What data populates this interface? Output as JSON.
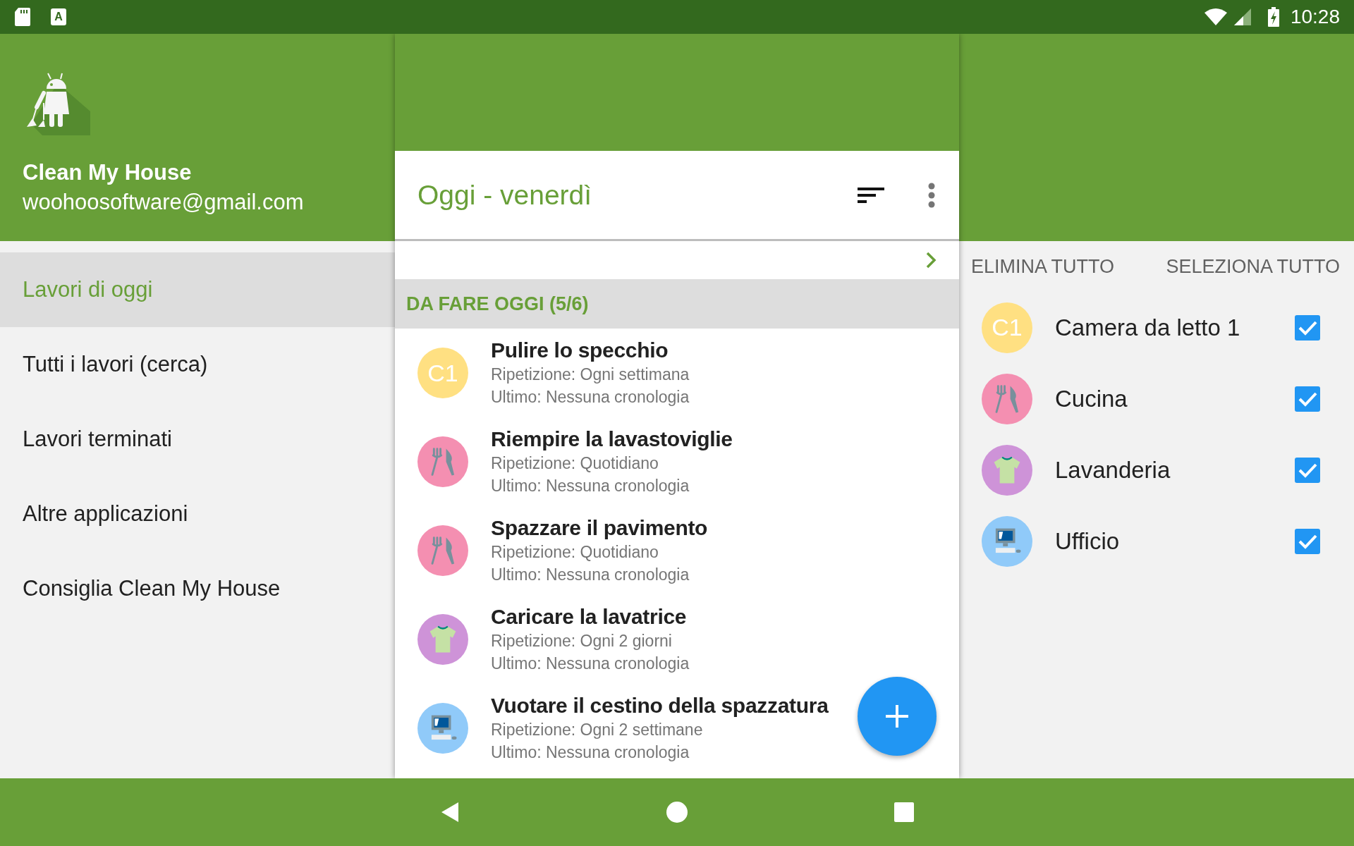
{
  "status_bar": {
    "keyboard_glyph": "A",
    "time": "10:28"
  },
  "drawer": {
    "app_name": "Clean My House",
    "email": "woohoosoftware@gmail.com",
    "items": [
      {
        "label": "Lavori di oggi",
        "selected": true
      },
      {
        "label": "Tutti i lavori (cerca)",
        "selected": false
      },
      {
        "label": "Lavori terminati",
        "selected": false
      },
      {
        "label": "Altre applicazioni",
        "selected": false
      },
      {
        "label": "Consiglia Clean My House",
        "selected": false
      }
    ]
  },
  "task_panel": {
    "title": "Oggi - venerdì",
    "section": "DA FARE OGGI (5/6)",
    "tasks": [
      {
        "title": "Pulire lo specchio",
        "repeat": "Ripetizione: Ogni settimana",
        "last": "Ultimo: Nessuna cronologia",
        "icon": {
          "kind": "initials",
          "text": "C1",
          "color": "#ffe082"
        }
      },
      {
        "title": "Riempire la lavastoviglie",
        "repeat": "Ripetizione: Quotidiano",
        "last": "Ultimo: Nessuna cronologia",
        "icon": {
          "kind": "cutlery",
          "color": "#f48fb1"
        }
      },
      {
        "title": "Spazzare il pavimento",
        "repeat": "Ripetizione: Quotidiano",
        "last": "Ultimo: Nessuna cronologia",
        "icon": {
          "kind": "cutlery",
          "color": "#f48fb1"
        }
      },
      {
        "title": "Caricare la lavatrice",
        "repeat": "Ripetizione: Ogni 2 giorni",
        "last": "Ultimo: Nessuna cronologia",
        "icon": {
          "kind": "shirt",
          "color": "#ce93d8"
        }
      },
      {
        "title": "Vuotare il cestino della spazzatura",
        "repeat": "Ripetizione: Ogni 2 settimane",
        "last": "Ultimo: Nessuna cronologia",
        "icon": {
          "kind": "computer",
          "color": "#90caf9"
        }
      }
    ]
  },
  "room_panel": {
    "actions": [
      "ELIMINA TUTTO",
      "SELEZIONA TUTTO"
    ],
    "rooms": [
      {
        "name": "Camera da letto 1",
        "checked": true,
        "icon": {
          "kind": "initials",
          "text": "C1",
          "color": "#ffe082"
        }
      },
      {
        "name": "Cucina",
        "checked": true,
        "icon": {
          "kind": "cutlery",
          "color": "#f48fb1"
        }
      },
      {
        "name": "Lavanderia",
        "checked": true,
        "icon": {
          "kind": "shirt",
          "color": "#ce93d8"
        }
      },
      {
        "name": "Ufficio",
        "checked": true,
        "icon": {
          "kind": "computer",
          "color": "#90caf9"
        }
      }
    ]
  }
}
